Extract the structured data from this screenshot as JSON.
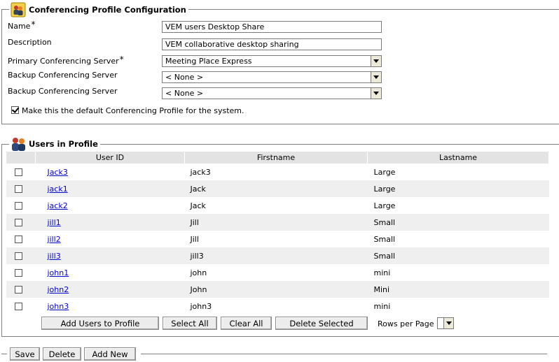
{
  "config_section": {
    "title": "Conferencing Profile Configuration",
    "icon": "conference-group-icon",
    "fields": {
      "name": {
        "label": "Name",
        "required_mark": "*",
        "value": "VEM users Desktop Share"
      },
      "description": {
        "label": "Description",
        "value": "VEM collaborative desktop sharing"
      },
      "primary_server": {
        "label": "Primary Conferencing Server",
        "required_mark": "*",
        "value": "Meeting Place Express"
      },
      "backup_server_1": {
        "label": "Backup Conferencing Server",
        "value": "< None >"
      },
      "backup_server_2": {
        "label": "Backup Conferencing Server",
        "value": "< None >"
      }
    },
    "default_checkbox": {
      "label": "Make this the default Conferencing Profile for the system.",
      "checked": true
    }
  },
  "users_section": {
    "title": "Users in Profile",
    "icon": "users-group-icon",
    "columns": [
      "User ID",
      "Firstname",
      "Lastname"
    ],
    "rows": [
      {
        "user_id": "Jack3",
        "firstname": "jack3",
        "lastname": "Large"
      },
      {
        "user_id": "jack1",
        "firstname": "Jack",
        "lastname": "Large"
      },
      {
        "user_id": "jack2",
        "firstname": "Jack",
        "lastname": "Large"
      },
      {
        "user_id": "jill1",
        "firstname": "Jill",
        "lastname": "Small"
      },
      {
        "user_id": "jill2",
        "firstname": "Jill",
        "lastname": "Small"
      },
      {
        "user_id": "jill3",
        "firstname": "jill3",
        "lastname": "Small"
      },
      {
        "user_id": "john1",
        "firstname": "john",
        "lastname": "mini"
      },
      {
        "user_id": "john2",
        "firstname": "John",
        "lastname": "Mini"
      },
      {
        "user_id": "john3",
        "firstname": "john3",
        "lastname": "mini"
      }
    ],
    "buttons": {
      "add_users": "Add Users to Profile",
      "select_all": "Select All",
      "clear_all": "Clear All",
      "delete_selected": "Delete Selected"
    },
    "rows_per_page_label": "Rows per Page"
  },
  "bottom_buttons": {
    "save": "Save",
    "delete": "Delete",
    "add_new": "Add New"
  },
  "figure_number": "228190",
  "colors": {
    "link": "#0000cc",
    "header_bg": "#e3e3e3",
    "alt_row_bg": "#efefef",
    "frame_border": "#7f7f7f"
  }
}
